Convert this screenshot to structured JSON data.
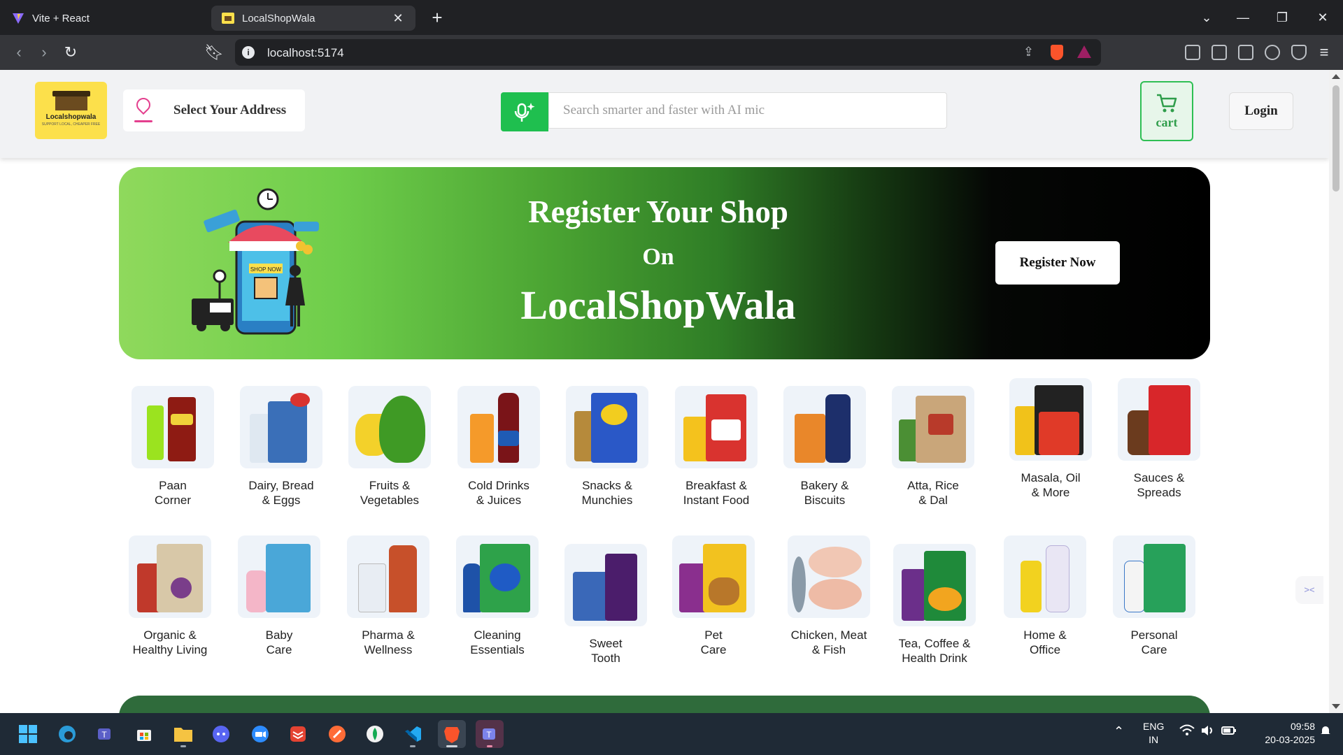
{
  "browser": {
    "tabs": [
      {
        "title": "Vite + React",
        "active": false
      },
      {
        "title": "LocalShopWala",
        "active": true
      }
    ],
    "url": "localhost:5174"
  },
  "header": {
    "logo_name": "Localshopwala",
    "logo_tagline": "SUPPORT LOCAL, CHEAPER FREE",
    "address_label": "Select Your Address",
    "search_placeholder": "Search smarter and faster with AI mic",
    "cart_label": "cart",
    "login_label": "Login"
  },
  "banner": {
    "line1": "Register Your Shop",
    "line2": "On",
    "line3": "LocalShopWala",
    "button": "Register Now",
    "illustration_text": "SHOP NOW"
  },
  "categories_row1": [
    {
      "label": "Paan\nCorner"
    },
    {
      "label": "Dairy, Bread\n& Eggs"
    },
    {
      "label": "Fruits &\nVegetables"
    },
    {
      "label": "Cold Drinks\n& Juices"
    },
    {
      "label": "Snacks &\nMunchies"
    },
    {
      "label": "Breakfast &\nInstant Food"
    },
    {
      "label": "Bakery &\nBiscuits"
    },
    {
      "label": "Atta, Rice\n& Dal"
    },
    {
      "label": "Masala, Oil\n& More"
    },
    {
      "label": "Sauces &\nSpreads"
    }
  ],
  "categories_row2": [
    {
      "label": "Organic &\nHealthy Living"
    },
    {
      "label": "Baby\nCare"
    },
    {
      "label": "Pharma &\nWellness"
    },
    {
      "label": "Cleaning\nEssentials"
    },
    {
      "label": "Sweet\nTooth"
    },
    {
      "label": "Pet\nCare"
    },
    {
      "label": "Chicken, Meat\n& Fish"
    },
    {
      "label": "Tea, Coffee &\nHealth Drink"
    },
    {
      "label": "Home &\nOffice"
    },
    {
      "label": "Personal\nCare"
    }
  ],
  "taskbar": {
    "lang1": "ENG",
    "lang2": "IN",
    "time": "09:58",
    "date": "20-03-2025"
  },
  "colors": {
    "accent_green": "#1fbf4f",
    "logo_yellow": "#fce04b",
    "pin_pink": "#e43f8e"
  }
}
